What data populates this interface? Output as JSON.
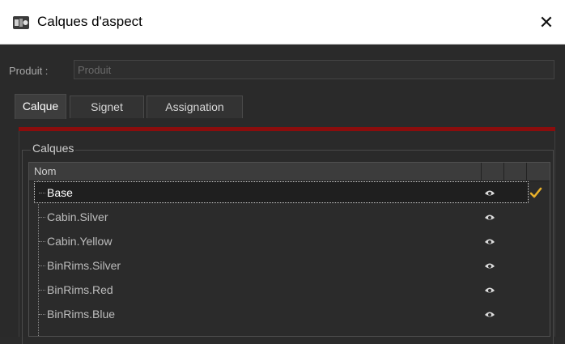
{
  "window": {
    "title": "Calques d'aspect",
    "close_glyph": "✕"
  },
  "product": {
    "label": "Produit :",
    "placeholder": "Produit",
    "value": ""
  },
  "tabs": [
    {
      "label": "Calque",
      "active": true
    },
    {
      "label": "Signet",
      "active": false
    },
    {
      "label": "Assignation",
      "active": false
    }
  ],
  "colors": {
    "accent_bar": "#8b0d0d",
    "check": "#e8b02a"
  },
  "layers_group": {
    "title": "Calques",
    "column_header": "Nom",
    "rows": [
      {
        "name": "Base",
        "visible_icon": "eye-icon",
        "active": true,
        "selected": true
      },
      {
        "name": "Cabin.Silver",
        "visible_icon": "eye-icon",
        "active": false,
        "selected": false
      },
      {
        "name": "Cabin.Yellow",
        "visible_icon": "eye-icon",
        "active": false,
        "selected": false
      },
      {
        "name": "BinRims.Silver",
        "visible_icon": "eye-icon",
        "active": false,
        "selected": false
      },
      {
        "name": "BinRims.Red",
        "visible_icon": "eye-icon",
        "active": false,
        "selected": false
      },
      {
        "name": "BinRims.Blue",
        "visible_icon": "eye-icon",
        "active": false,
        "selected": false
      }
    ]
  }
}
